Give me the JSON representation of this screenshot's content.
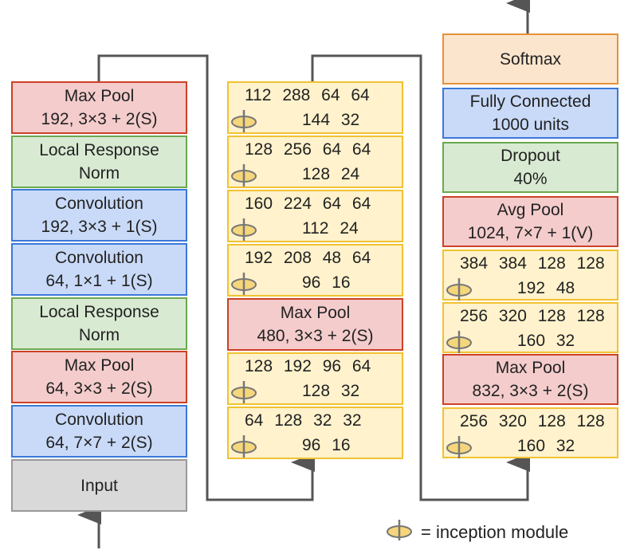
{
  "column1": [
    {
      "lines": [
        "Max Pool",
        "192, 3×3 + 2(S)"
      ],
      "color": "red"
    },
    {
      "lines": [
        "Local Response",
        "Norm"
      ],
      "color": "green"
    },
    {
      "lines": [
        "Convolution",
        "192, 3×3 + 1(S)"
      ],
      "color": "blue"
    },
    {
      "lines": [
        "Convolution",
        "64, 1×1 + 1(S)"
      ],
      "color": "blue"
    },
    {
      "lines": [
        "Local Response",
        "Norm"
      ],
      "color": "green"
    },
    {
      "lines": [
        "Max Pool",
        "64, 3×3 + 2(S)"
      ],
      "color": "red"
    },
    {
      "lines": [
        "Convolution",
        "64, 7×7 + 2(S)"
      ],
      "color": "blue"
    },
    {
      "lines": [
        "Input",
        ""
      ],
      "color": "gray"
    }
  ],
  "column2": [
    {
      "type": "inception",
      "top": "112 288 64 64",
      "bottom": "144 32"
    },
    {
      "type": "inception",
      "top": "128 256 64 64",
      "bottom": "128 24"
    },
    {
      "type": "inception",
      "top": "160 224 64 64",
      "bottom": "112 24"
    },
    {
      "type": "inception",
      "top": "192 208 48 64",
      "bottom": "96 16"
    },
    {
      "type": "layer",
      "lines": [
        "Max Pool",
        "480, 3×3 + 2(S)"
      ],
      "color": "red"
    },
    {
      "type": "inception",
      "top": "128 192 96 64",
      "bottom": "128 32"
    },
    {
      "type": "inception",
      "top": "64 128 32 32",
      "bottom": "96 16"
    }
  ],
  "column3": [
    {
      "type": "layer",
      "lines": [
        "Softmax",
        ""
      ],
      "color": "orange"
    },
    {
      "type": "layer",
      "lines": [
        "Fully Connected",
        "1000 units"
      ],
      "color": "blue"
    },
    {
      "type": "layer",
      "lines": [
        "Dropout",
        "40%"
      ],
      "color": "green"
    },
    {
      "type": "layer",
      "lines": [
        "Avg Pool",
        "1024, 7×7 + 1(V)"
      ],
      "color": "red"
    },
    {
      "type": "inception",
      "top": "384 384 128 128",
      "bottom": "192 48"
    },
    {
      "type": "inception",
      "top": "256 320 128 128",
      "bottom": "160 32"
    },
    {
      "type": "layer",
      "lines": [
        "Max Pool",
        "832, 3×3 + 2(S)"
      ],
      "color": "red"
    },
    {
      "type": "inception",
      "top": "256 320 128 128",
      "bottom": "160 32"
    }
  ],
  "legend": {
    "icon": "inception-module-icon",
    "text": "= inception module"
  }
}
